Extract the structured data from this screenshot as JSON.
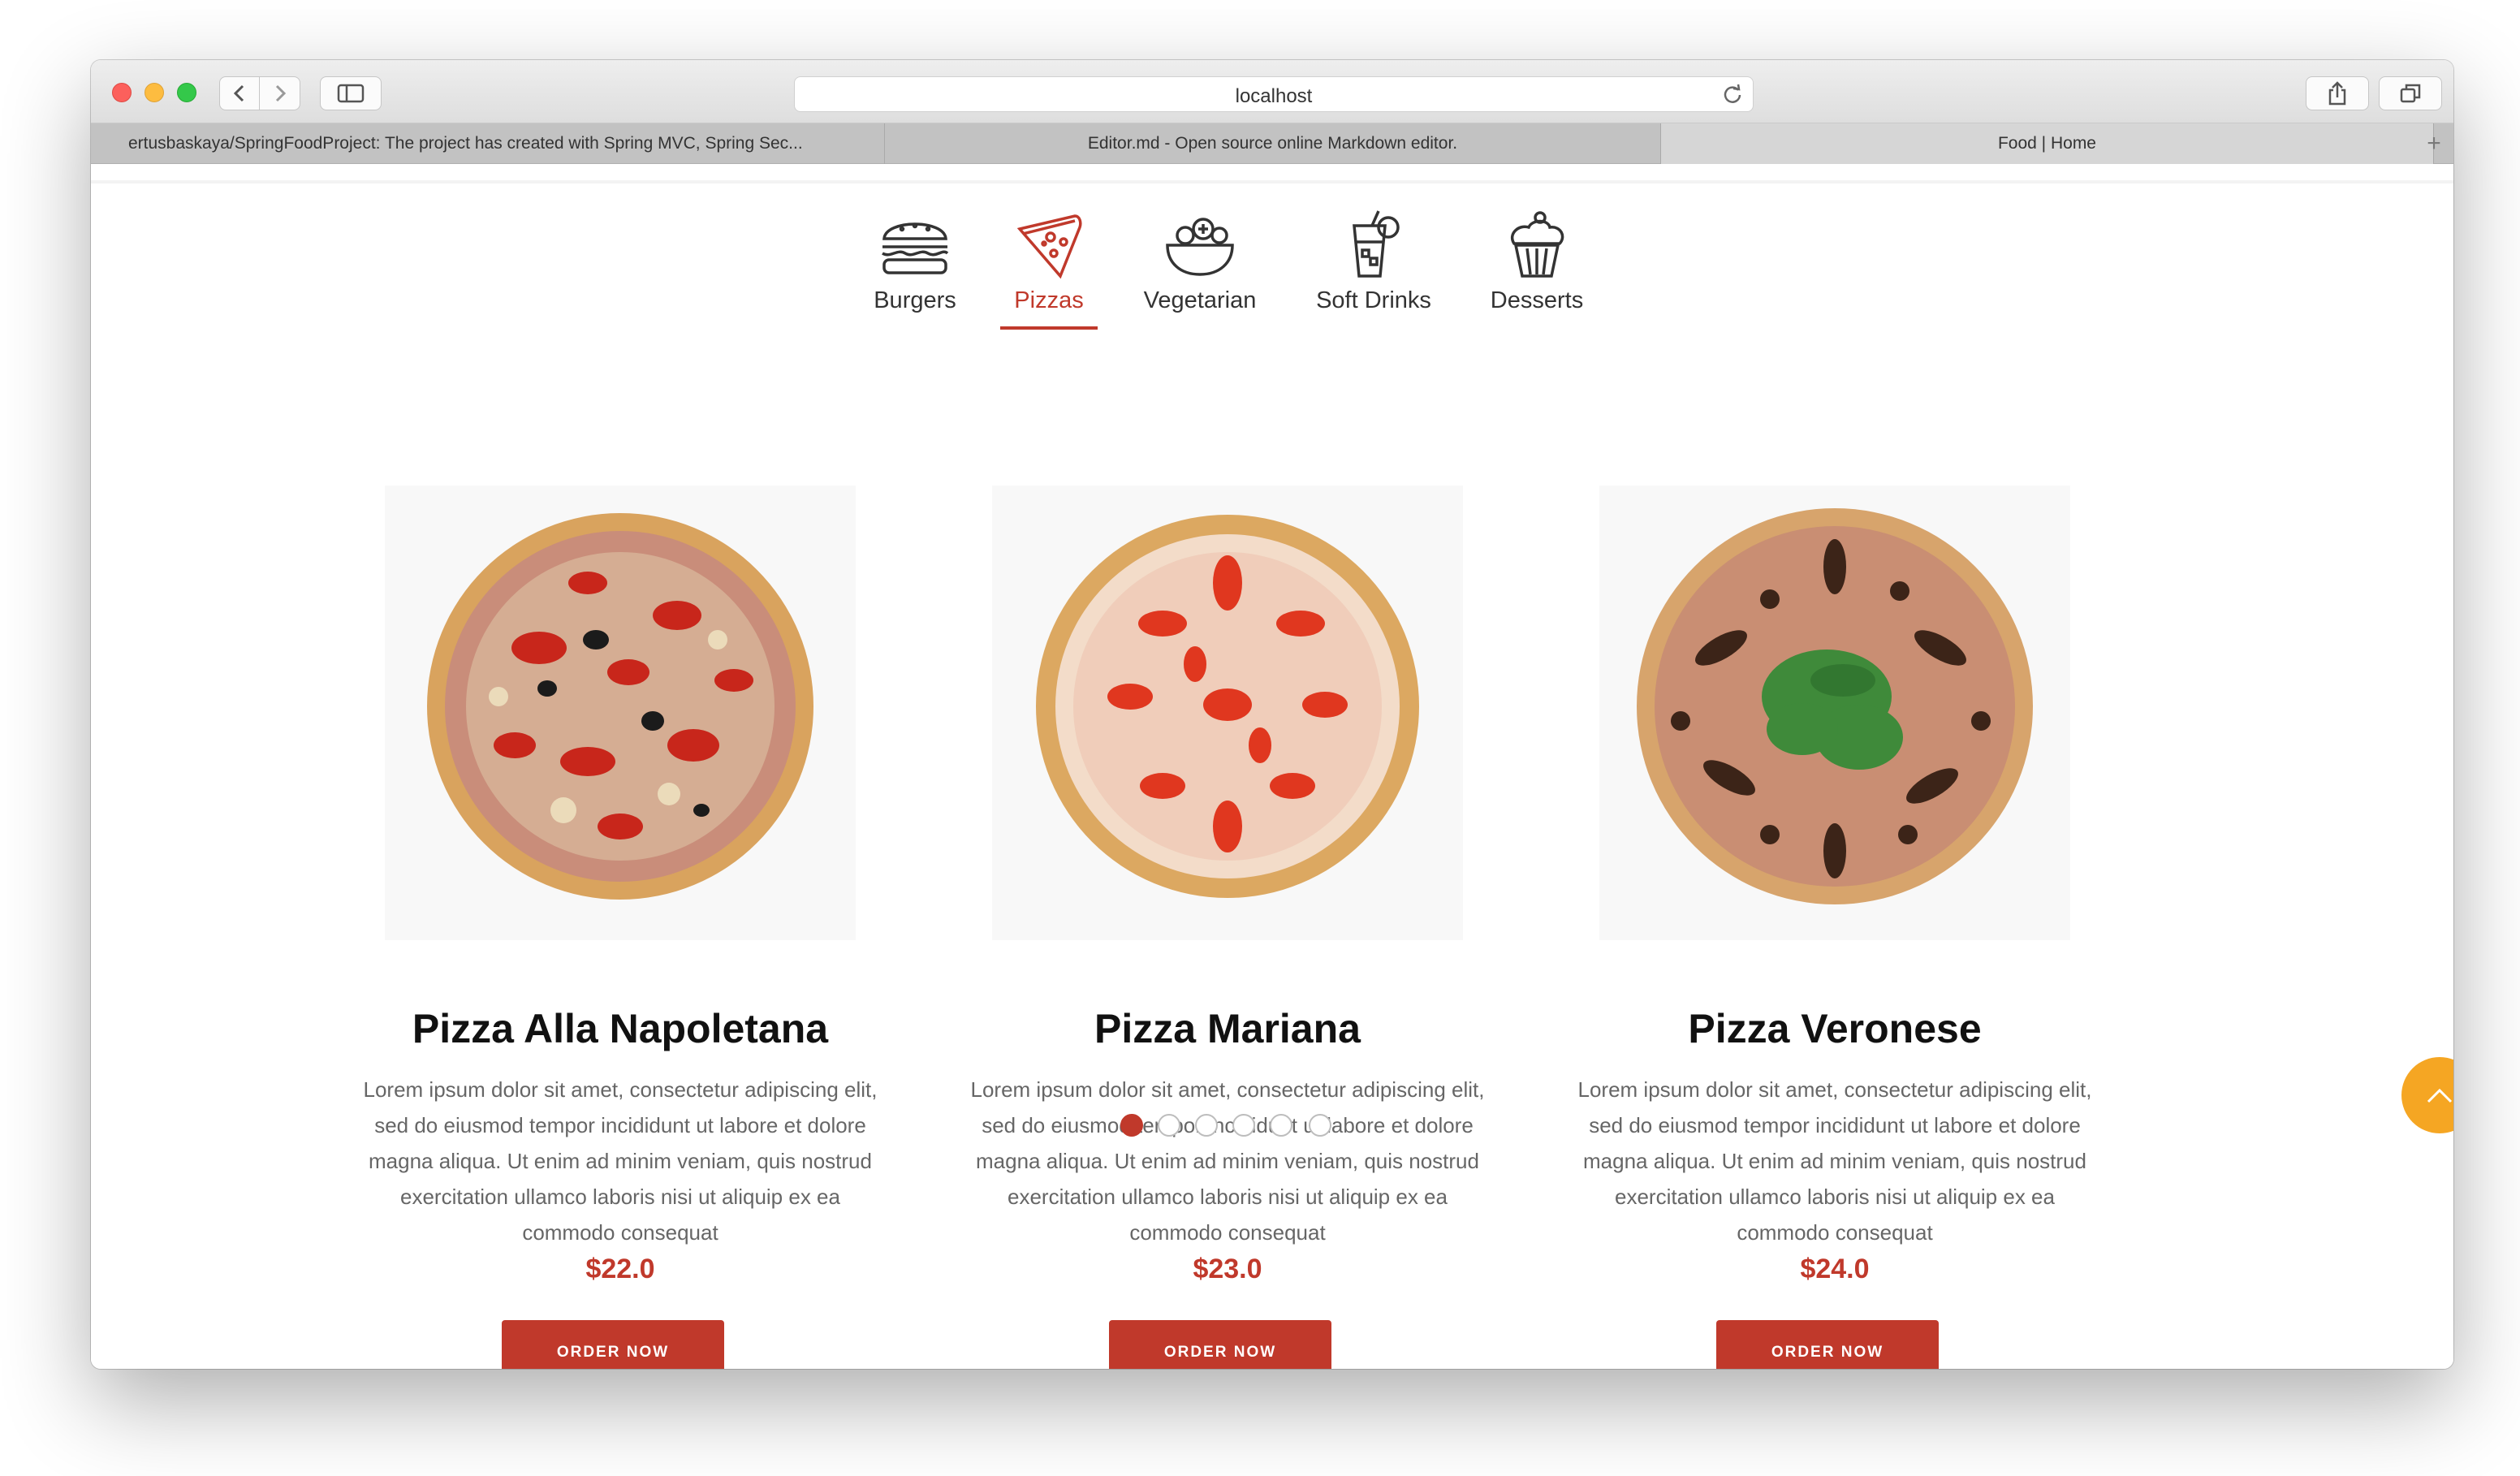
{
  "browser": {
    "url": "localhost",
    "tabs": [
      {
        "label": "ertusbaskaya/SpringFoodProject: The project has created with Spring MVC, Spring Sec..."
      },
      {
        "label": "Editor.md - Open source online Markdown editor."
      },
      {
        "label": "Food | Home",
        "active": true
      }
    ],
    "new_tab_label": "+"
  },
  "categories": [
    {
      "label": "Burgers",
      "icon": "burger-icon"
    },
    {
      "label": "Pizzas",
      "icon": "pizza-slice-icon",
      "active": true
    },
    {
      "label": "Vegetarian",
      "icon": "salad-bowl-icon"
    },
    {
      "label": "Soft Drinks",
      "icon": "drink-glass-icon"
    },
    {
      "label": "Desserts",
      "icon": "cupcake-icon"
    }
  ],
  "items": [
    {
      "title": "Pizza Alla Napoletana",
      "description": "Lorem ipsum dolor sit amet, consectetur adipiscing elit, sed do eiusmod tempor incididunt ut labore et dolore magna aliqua. Ut enim ad minim veniam, quis nostrud exercitation ullamco laboris nisi ut aliquip ex ea commodo consequat",
      "price": "$22.0",
      "button": "ORDER NOW"
    },
    {
      "title": "Pizza Mariana",
      "description": "Lorem ipsum dolor sit amet, consectetur adipiscing elit, sed do eiusmod tempor incididunt ut labore et dolore magna aliqua. Ut enim ad minim veniam, quis nostrud exercitation ullamco laboris nisi ut aliquip ex ea commodo consequat",
      "price": "$23.0",
      "button": "ORDER NOW"
    },
    {
      "title": "Pizza Veronese",
      "description": "Lorem ipsum dolor sit amet, consectetur adipiscing elit, sed do eiusmod tempor incididunt ut labore et dolore magna aliqua. Ut enim ad minim veniam, quis nostrud exercitation ullamco laboris nisi ut aliquip ex ea commodo consequat",
      "price": "$24.0",
      "button": "ORDER NOW"
    }
  ],
  "carousel": {
    "pages": 6,
    "active_page": 1
  },
  "colors": {
    "accent": "#c0392b",
    "scroll_button": "#f5a623"
  }
}
